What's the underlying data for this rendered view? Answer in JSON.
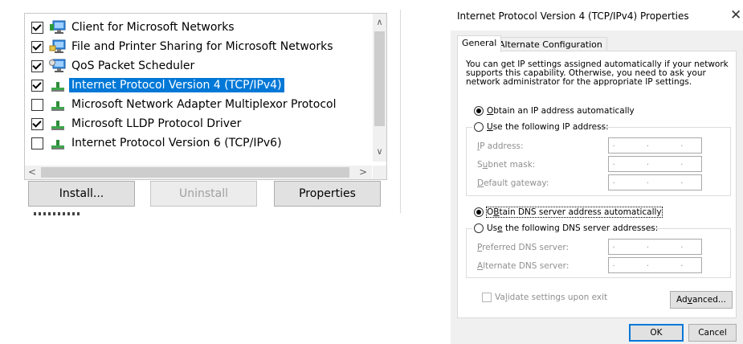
{
  "left_panel": {
    "items": [
      {
        "label": "Client for Microsoft Networks",
        "checked": true,
        "icon": "network-client-icon"
      },
      {
        "label": "File and Printer Sharing for Microsoft Networks",
        "checked": true,
        "icon": "file-printer-sharing-icon"
      },
      {
        "label": "QoS Packet Scheduler",
        "checked": true,
        "icon": "qos-scheduler-icon"
      },
      {
        "label": "Internet Protocol Version 4 (TCP/IPv4)",
        "checked": true,
        "icon": "network-protocol-icon",
        "selected": true
      },
      {
        "label": "Microsoft Network Adapter Multiplexor Protocol",
        "checked": false,
        "icon": "network-protocol-icon"
      },
      {
        "label": "Microsoft LLDP Protocol Driver",
        "checked": true,
        "icon": "network-protocol-icon"
      },
      {
        "label": "Internet Protocol Version 6 (TCP/IPv6)",
        "checked": false,
        "icon": "network-protocol-icon"
      }
    ],
    "scroll_up": "∧",
    "scroll_down": "∨",
    "scroll_left": "<",
    "scroll_right": ">",
    "buttons": {
      "install": "Install...",
      "uninstall": "Uninstall",
      "properties": "Properties"
    }
  },
  "dialog": {
    "title": "Internet Protocol Version 4 (TCP/IPv4) Properties",
    "close": "✕",
    "tabs": [
      {
        "label": "General",
        "active": true
      },
      {
        "label": "Alternate Configuration",
        "active": false
      }
    ],
    "description": "You can get IP settings assigned automatically if your network supports this capability. Otherwise, you need to ask your network administrator for the appropriate IP settings.",
    "ip_mode": {
      "auto": {
        "label_key": "O",
        "label_rest": "btain an IP address automatically"
      },
      "manual": {
        "label_key": "U",
        "label_rest": "se the following IP address:"
      },
      "selected": "auto"
    },
    "ip_fields": [
      {
        "key": "I",
        "rest": "P address:",
        "value": ". . ."
      },
      {
        "pre": "S",
        "key": "u",
        "rest": "bnet mask:",
        "value": ". . ."
      },
      {
        "key": "D",
        "rest": "efault gateway:",
        "value": ". . ."
      }
    ],
    "dns_mode": {
      "auto": {
        "label_key": "B",
        "label_pre": "O",
        "label_rest": "tain DNS server address automatically"
      },
      "manual": {
        "label_pre": "Us",
        "label_key": "e",
        "label_rest": " the following DNS server addresses:"
      },
      "selected": "auto"
    },
    "dns_fields": [
      {
        "key": "P",
        "rest": "referred DNS server:",
        "value": ". . ."
      },
      {
        "key": "A",
        "rest": "lternate DNS server:",
        "value": ". . ."
      }
    ],
    "validate": {
      "pre": "Va",
      "key": "l",
      "rest": "idate settings upon exit",
      "checked": false
    },
    "buttons": {
      "advanced_pre": "Ad",
      "advanced_key": "v",
      "advanced_rest": "anced...",
      "ok": "OK",
      "cancel": "Cancel"
    }
  }
}
